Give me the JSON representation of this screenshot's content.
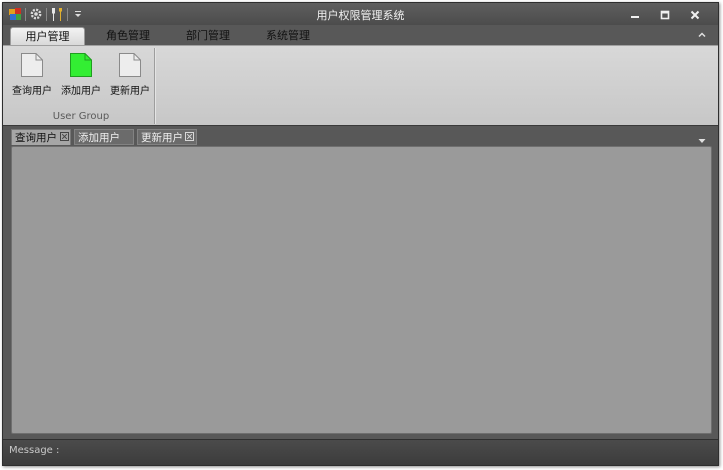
{
  "window": {
    "title": "用户权限管理系统"
  },
  "quick_access": {
    "icons": [
      "app-logo-icon",
      "gear-icon",
      "tools-icon",
      "customize-dropdown-icon"
    ]
  },
  "ribbon_tabs": [
    {
      "label": "用户管理",
      "active": true
    },
    {
      "label": "角色管理",
      "active": false
    },
    {
      "label": "部门管理",
      "active": false
    },
    {
      "label": "系统管理",
      "active": false
    }
  ],
  "ribbon": {
    "group_label": "User Group",
    "buttons": [
      {
        "label": "查询用户",
        "icon": "document-icon",
        "color": "#ededed"
      },
      {
        "label": "添加用户",
        "icon": "document-icon",
        "color": "#33ee33"
      },
      {
        "label": "更新用户",
        "icon": "document-icon",
        "color": "#ededed"
      }
    ]
  },
  "doc_tabs": [
    {
      "label": "查询用户",
      "active": true,
      "closable": true
    },
    {
      "label": "添加用户",
      "active": false,
      "closable": false
    },
    {
      "label": "更新用户",
      "active": false,
      "closable": true
    }
  ],
  "status": {
    "text": "Message :"
  }
}
